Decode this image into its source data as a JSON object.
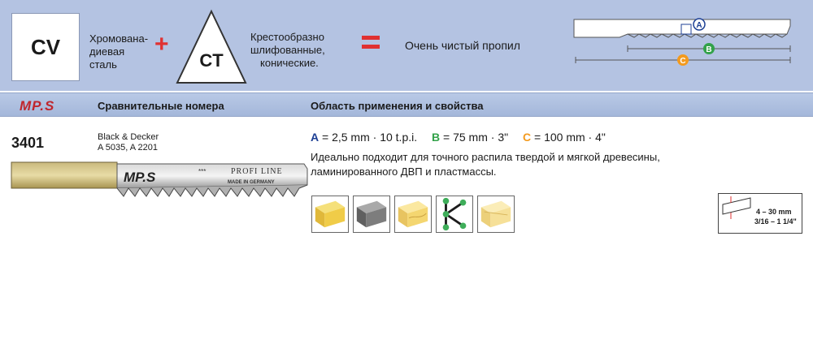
{
  "banner": {
    "material_code": "CV",
    "material_desc": [
      "Хромована-",
      "диевая",
      "сталь"
    ],
    "plus": "+",
    "tooth_code": "CT",
    "tooth_desc": [
      "Крестообразно",
      "шлифованные,",
      "конические."
    ],
    "result": "Очень чистый пропил",
    "diagram_labels": {
      "a": "A",
      "b": "B",
      "c": "C"
    }
  },
  "strip": {
    "brand": "MP.S",
    "col1": "Сравнительные номера",
    "col2": "Область применения и свойства"
  },
  "product": {
    "article": "3401",
    "crossref": [
      "Black & Decker",
      "A 5035, A 2201"
    ],
    "blade_brand": "MP.S",
    "blade_line": "PROFI LINE",
    "blade_origin": "MADE IN GERMANY",
    "blade_stars": "***",
    "dims": {
      "a_key": "A",
      "a_val": "= 2,5 mm · 10 t.p.i.",
      "b_key": "B",
      "b_val": "= 75 mm · 3\"",
      "c_key": "C",
      "c_val": "= 100 mm · 4\""
    },
    "application": [
      "Идеально подходит для точного распила твердой и мягкой древесины,",
      "ламинированного ДВП и пластмассы."
    ],
    "materials": [
      "hardwood-icon",
      "laminated-board-icon",
      "softwood-icon",
      "curve-cut-icon",
      "plastic-icon"
    ],
    "thickness": {
      "metric": "4 – 30 mm",
      "imperial": "3/16 – 1 1/4\""
    }
  },
  "colors": {
    "accent_red": "#e03131",
    "banner_blue": "#b4c3e2",
    "a_blue": "#1c3f94",
    "b_green": "#33a24a",
    "c_orange": "#f39a1e"
  }
}
